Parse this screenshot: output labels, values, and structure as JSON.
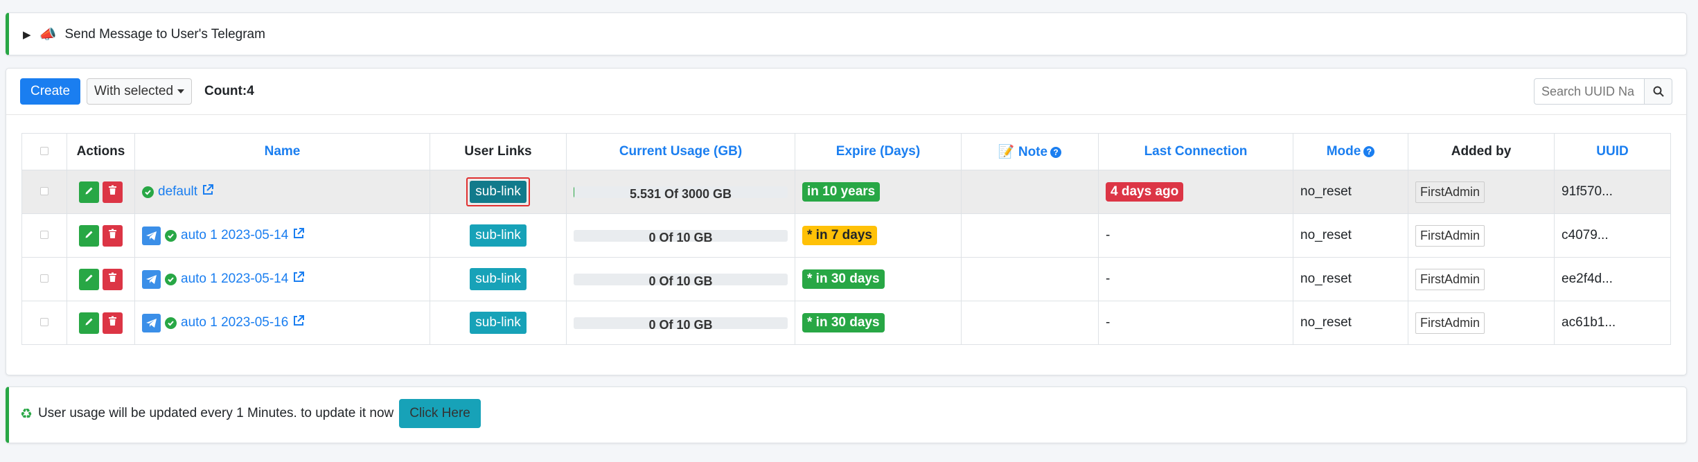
{
  "telegram": {
    "summary": "Send Message to User's Telegram"
  },
  "toolbar": {
    "create_label": "Create",
    "with_selected_label": "With selected",
    "count_label": "Count:4",
    "search_placeholder": "Search UUID Na"
  },
  "table": {
    "headers": {
      "actions": "Actions",
      "name": "Name",
      "user_links": "User Links",
      "usage": "Current Usage (GB)",
      "expire": "Expire (Days)",
      "note": "Note",
      "last_connection": "Last Connection",
      "mode": "Mode",
      "added_by": "Added by",
      "uuid": "UUID"
    },
    "rows": [
      {
        "name": "default",
        "sub_link": "sub-link",
        "usage": "5.531 Of 3000 GB",
        "usage_fraction": 0.002,
        "expire": "in 10 years",
        "expire_color": "green",
        "last_connection": "4 days ago",
        "mode": "no_reset",
        "added_by": "FirstAdmin",
        "uuid": "91f570..."
      },
      {
        "name": "auto 1 2023-05-14",
        "sub_link": "sub-link",
        "usage": "0 Of 10 GB",
        "usage_fraction": 0,
        "expire": "* in 7 days",
        "expire_color": "yellow",
        "last_connection": "-",
        "mode": "no_reset",
        "added_by": "FirstAdmin",
        "uuid": "c4079..."
      },
      {
        "name": "auto 1 2023-05-14",
        "sub_link": "sub-link",
        "usage": "0 Of 10 GB",
        "usage_fraction": 0,
        "expire": "* in 30 days",
        "expire_color": "green",
        "last_connection": "-",
        "mode": "no_reset",
        "added_by": "FirstAdmin",
        "uuid": "ee2f4d..."
      },
      {
        "name": "auto 1 2023-05-16",
        "sub_link": "sub-link",
        "usage": "0 Of 10 GB",
        "usage_fraction": 0,
        "expire": "* in 30 days",
        "expire_color": "green",
        "last_connection": "-",
        "mode": "no_reset",
        "added_by": "FirstAdmin",
        "uuid": "ac61b1..."
      }
    ]
  },
  "update": {
    "message": "User usage will be updated every 1 Minutes. to update it now",
    "button_label": "Click Here"
  },
  "colors": {
    "primary": "#1a7ef0",
    "success": "#28a745",
    "danger": "#dc3545",
    "warning": "#ffc107",
    "info": "#17a2b8"
  },
  "icons": [
    "triangle-right-icon",
    "megaphone-icon",
    "caret-down-icon",
    "search-icon",
    "pencil-icon",
    "trash-icon",
    "check-circle-icon",
    "external-link-icon",
    "telegram-icon",
    "memo-icon",
    "question-circle-icon",
    "recycle-icon"
  ]
}
